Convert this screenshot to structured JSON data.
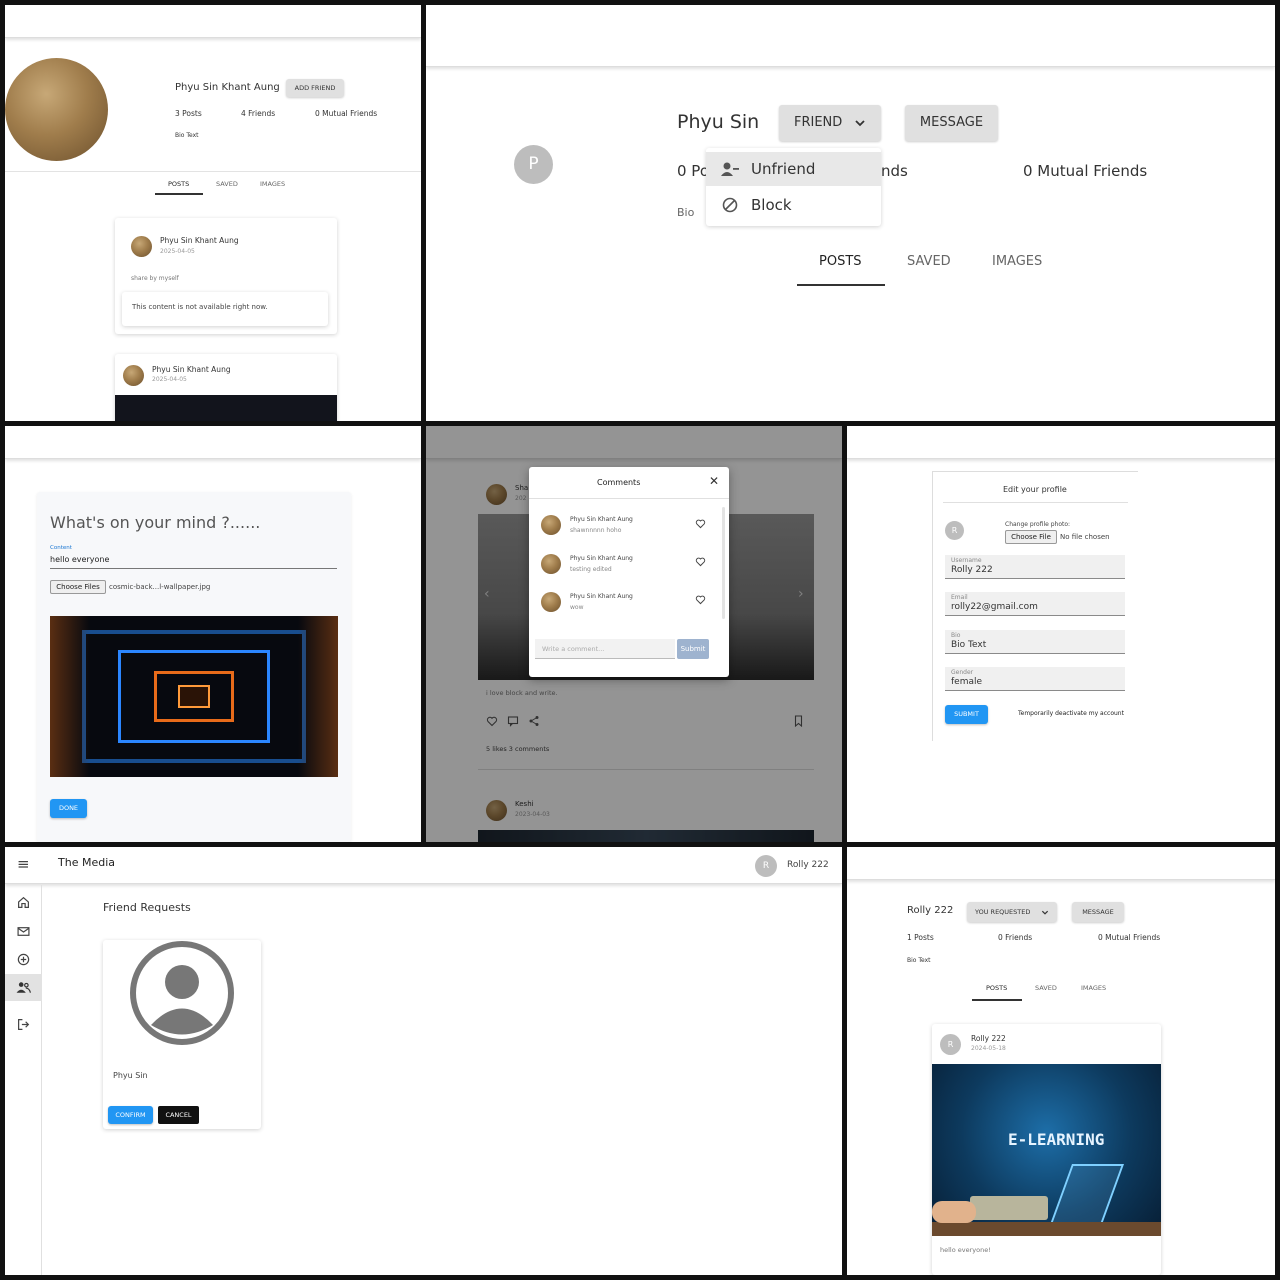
{
  "p1": {
    "username": "Phyu Sin Khant Aung",
    "add_friend": "ADD FRIEND",
    "posts": "3 Posts",
    "friends": "4 Friends",
    "mutual": "0 Mutual Friends",
    "bio": "Bio Text",
    "tabs": [
      "POSTS",
      "SAVED",
      "IMAGES"
    ],
    "post1": {
      "author": "Phyu Sin Khant Aung",
      "date": "2025-04-05",
      "caption": "share by myself",
      "notice": "This content is not available right now."
    },
    "post2": {
      "author": "Phyu Sin Khant Aung",
      "date": "2025-04-05"
    }
  },
  "p2": {
    "username": "Phyu Sin",
    "friend_btn": "FRIEND",
    "message_btn": "MESSAGE",
    "avatar_letter": "P",
    "posts_partial": "0 Po",
    "friends_partial": "nds",
    "mutual": "0 Mutual Friends",
    "bio_partial": "Bio",
    "menu": [
      "Unfriend",
      "Block"
    ],
    "tabs": [
      "POSTS",
      "SAVED",
      "IMAGES"
    ]
  },
  "p3": {
    "heading": "What's on your mind ?......",
    "content_label": "Content",
    "content_value": "hello everyone",
    "choose_files": "Choose Files",
    "file_name": "cosmic-back...l-wallpaper.jpg",
    "done": "DONE"
  },
  "p4": {
    "modal_title": "Comments",
    "comments": [
      {
        "author": "Phyu Sin Khant Aung",
        "text": "shawnnnnn hoho"
      },
      {
        "author": "Phyu Sin Khant Aung",
        "text": "testing edited"
      },
      {
        "author": "Phyu Sin Khant Aung",
        "text": "wow"
      }
    ],
    "comment_placeholder": "Write a comment...",
    "submit": "Submit",
    "bg_author_partial": "Sha",
    "bg_date_partial": "202",
    "bg_caption": "i love block and write.",
    "bg_stats": "5 likes  3 comments",
    "bg_author2": "Keshi",
    "bg_date2": "2023-04-03"
  },
  "p5": {
    "title": "Edit your profile",
    "avatar_letter": "R",
    "change_photo": "Change profile photo:",
    "choose_file": "Choose File",
    "no_file": "No file chosen",
    "fields": [
      {
        "label": "Username",
        "value": "Rolly 222"
      },
      {
        "label": "Email",
        "value": "rolly22@gmail.com"
      },
      {
        "label": "Bio",
        "value": "Bio Text"
      },
      {
        "label": "Gender",
        "value": "female"
      }
    ],
    "submit": "SUBMIT",
    "deactivate": "Temporarily deactivate my account"
  },
  "p6": {
    "app_title": "The Media",
    "user_letter": "R",
    "user_name": "Rolly 222",
    "section_title": "Friend Requests",
    "request_name": "Phyu Sin",
    "confirm": "CONFIRM",
    "cancel": "CANCEL",
    "nav_icons": [
      "home-icon",
      "mail-icon",
      "add-circle-icon",
      "people-icon",
      "logout-icon"
    ]
  },
  "p7": {
    "username": "Rolly 222",
    "requested_btn": "YOU REQUESTED",
    "message_btn": "MESSAGE",
    "posts": "1 Posts",
    "friends": "0 Friends",
    "mutual": "0 Mutual Friends",
    "bio": "Bio Text",
    "tabs": [
      "POSTS",
      "SAVED",
      "IMAGES"
    ],
    "post": {
      "avatar_letter": "R",
      "author": "Rolly 222",
      "date": "2024-05-18",
      "image_text": "E-LEARNING",
      "caption": "hello everyone!"
    }
  }
}
